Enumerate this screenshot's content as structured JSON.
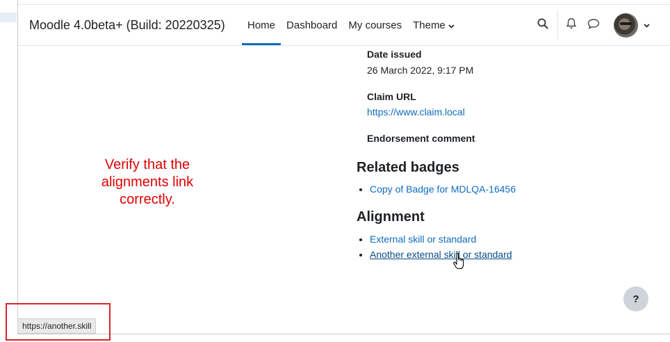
{
  "navbar": {
    "site_name": "Moodle 4.0beta+ (Build: 20220325)",
    "links": [
      {
        "label": "Home",
        "active": true
      },
      {
        "label": "Dashboard",
        "active": false
      },
      {
        "label": "My courses",
        "active": false
      },
      {
        "label": "Theme",
        "active": false,
        "has_dropdown": true
      }
    ],
    "icons": [
      "search-icon",
      "bell-icon",
      "chat-bubble-icon",
      "avatar",
      "chevron-down-icon"
    ]
  },
  "badge_details": {
    "date_issued_label": "Date issued",
    "date_issued_value": "26 March 2022, 9:17 PM",
    "claim_url_label": "Claim URL",
    "claim_url_value": "https://www.claim.local",
    "endorsement_comment_label": "Endorsement comment"
  },
  "related_badges": {
    "title": "Related badges",
    "items": [
      "Copy of Badge for MDLQA-16456"
    ]
  },
  "alignment": {
    "title": "Alignment",
    "items": [
      "External skill or standard",
      "Another external skill or standard"
    ]
  },
  "annotation": {
    "line1": "Verify that the",
    "line2": "alignments link",
    "line3": "correctly."
  },
  "help_button": {
    "label": "?"
  },
  "status_bar": {
    "url": "https://another.skill"
  },
  "colors": {
    "link": "#0f6cbf",
    "annotation": "#e00000",
    "highlight_box": "#d9232d"
  }
}
